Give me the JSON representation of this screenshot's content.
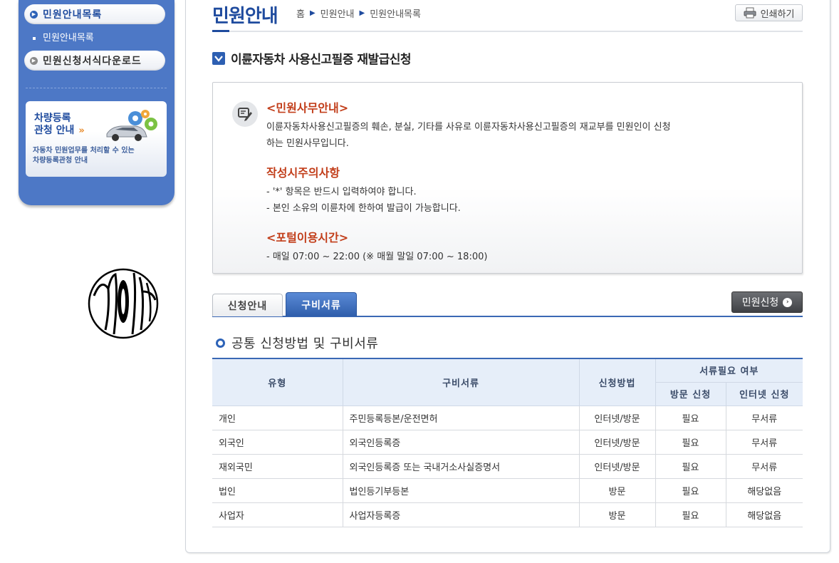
{
  "sidebar": {
    "menu_guide_list": "민원안내목록",
    "sub_guide_list": "민원안내목록",
    "menu_forms_download": "민원신청서식다운로드",
    "banner": {
      "title_line1": "차량등록",
      "title_line2": "관청 안내",
      "arrow": "»",
      "desc_line1": "자동차 민원업무를 처리할 수 있는",
      "desc_line2": "차량등록관청 안내"
    }
  },
  "header": {
    "title": "민원안내",
    "breadcrumb": [
      "홈",
      "민원안내",
      "민원안내목록"
    ],
    "print_label": "인쇄하기"
  },
  "section": {
    "title": "이륜자동차 사용신고필증 재발급신청"
  },
  "info": {
    "office_head": "<민원사무안내>",
    "office_line1": "이륜자동차사용신고필증의 훼손, 분실, 기타를 사유로 이륜자동차사용신고필증의 재교부를 민원인이 신청",
    "office_line2": "하는 민원사무입니다.",
    "caution_head": "작성시주의사항",
    "caution_line1": "- '*' 항목은 반드시 입력하여야 합니다.",
    "caution_line2": "- 본인 소유의 이륜차에 한하여 발급이 가능합니다.",
    "hours_head": "<포털이용시간>",
    "hours_line1": "- 매일 07:00 ~ 22:00 (※ 매월 말일 07:00 ~ 18:00)"
  },
  "tabs": {
    "guide": "신청안내",
    "docs": "구비서류"
  },
  "apply_button": "민원신청",
  "docs_section": {
    "title": "공통 신청방법 및 구비서류",
    "headers": {
      "type": "유형",
      "docs": "구비서류",
      "method": "신청방법",
      "need": "서류필요 여부",
      "visit": "방문 신청",
      "internet": "인터넷 신청"
    },
    "rows": [
      {
        "type": "개인",
        "docs": "주민등록등본/운전면허",
        "method": "인터넷/방문",
        "visit": "필요",
        "internet": "무서류"
      },
      {
        "type": "외국인",
        "docs": "외국인등록증",
        "method": "인터넷/방문",
        "visit": "필요",
        "internet": "무서류"
      },
      {
        "type": "재외국민",
        "docs": "외국인등록증 또는 국내거소사실증명서",
        "method": "인터넷/방문",
        "visit": "필요",
        "internet": "무서류"
      },
      {
        "type": "법인",
        "docs": "법인등기부등본",
        "method": "방문",
        "visit": "필요",
        "internet": "해당없음"
      },
      {
        "type": "사업자",
        "docs": "사업자등록증",
        "method": "방문",
        "visit": "필요",
        "internet": "해당없음"
      }
    ]
  },
  "colors": {
    "brand_blue": "#1f4b9e",
    "sidebar_blue": "#4d78c6",
    "accent_red": "#c23e1a"
  },
  "icons": [
    "circle-arrow-icon",
    "printer-icon",
    "checkbox-icon",
    "memo-pen-icon",
    "ring-bullet-icon",
    "car-gear-icon",
    "stamp-logo"
  ]
}
